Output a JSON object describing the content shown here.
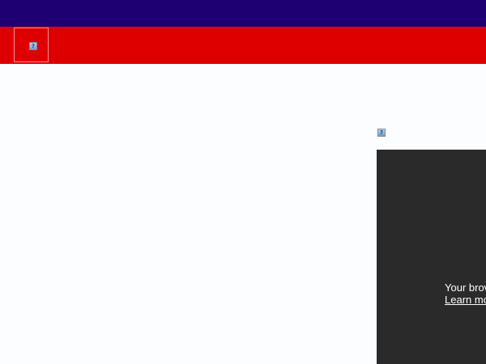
{
  "colors": {
    "top_bar": "#1f0072",
    "nav_bar": "#de0000",
    "page_bg": "#fcfdff",
    "video_bg": "#2a2a2a"
  },
  "header": {
    "logo_icon": "broken-image-icon",
    "logo_glyph": "?"
  },
  "main": {
    "image_icon": "broken-image-icon",
    "image_glyph": "?"
  },
  "video": {
    "message": "Your brov",
    "link_label": "Learn mo"
  }
}
